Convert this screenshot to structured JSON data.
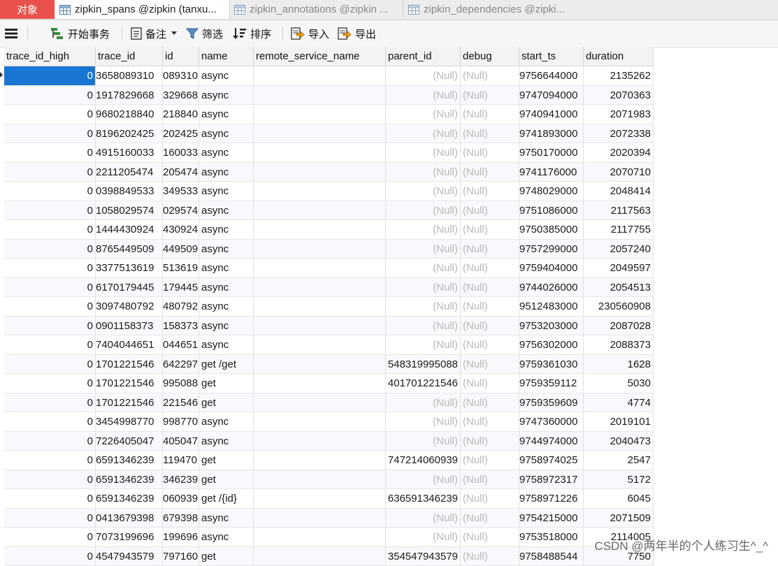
{
  "tabs": {
    "objects": "对象",
    "items": [
      {
        "label": "zipkin_spans @zipkin (tanxu..."
      },
      {
        "label": "zipkin_annotations @zipkin ..."
      },
      {
        "label": "zipkin_dependencies @zipki..."
      }
    ]
  },
  "toolbar": {
    "begin_transaction": "开始事务",
    "note": "备注",
    "filter": "筛选",
    "sort": "排序",
    "import": "导入",
    "export": "导出"
  },
  "columns": [
    "trace_id_high",
    "trace_id",
    "id",
    "name",
    "remote_service_name",
    "parent_id",
    "debug",
    "start_ts",
    "duration"
  ],
  "rows": [
    [
      "0",
      "3658089310",
      "089310",
      "async",
      "",
      "(Null)",
      "(Null)",
      "9756644000",
      "2135262"
    ],
    [
      "0",
      "1917829668",
      "329668",
      "async",
      "",
      "(Null)",
      "(Null)",
      "9747094000",
      "2070363"
    ],
    [
      "0",
      "9680218840",
      "218840",
      "async",
      "",
      "(Null)",
      "(Null)",
      "9740941000",
      "2071983"
    ],
    [
      "0",
      "8196202425",
      "202425",
      "async",
      "",
      "(Null)",
      "(Null)",
      "9741893000",
      "2072338"
    ],
    [
      "0",
      "4915160033",
      "160033",
      "async",
      "",
      "(Null)",
      "(Null)",
      "9750170000",
      "2020394"
    ],
    [
      "0",
      "2211205474",
      "205474",
      "async",
      "",
      "(Null)",
      "(Null)",
      "9741176000",
      "2070710"
    ],
    [
      "0",
      "0398849533",
      "349533",
      "async",
      "",
      "(Null)",
      "(Null)",
      "9748029000",
      "2048414"
    ],
    [
      "0",
      "1058029574",
      "029574",
      "async",
      "",
      "(Null)",
      "(Null)",
      "9751086000",
      "2117563"
    ],
    [
      "0",
      "1444430924",
      "430924",
      "async",
      "",
      "(Null)",
      "(Null)",
      "9750385000",
      "2117755"
    ],
    [
      "0",
      "8765449509",
      "449509",
      "async",
      "",
      "(Null)",
      "(Null)",
      "9757299000",
      "2057240"
    ],
    [
      "0",
      "3377513619",
      "513619",
      "async",
      "",
      "(Null)",
      "(Null)",
      "9759404000",
      "2049597"
    ],
    [
      "0",
      "6170179445",
      "179445",
      "async",
      "",
      "(Null)",
      "(Null)",
      "9744026000",
      "2054513"
    ],
    [
      "0",
      "3097480792",
      "480792",
      "async",
      "",
      "(Null)",
      "(Null)",
      "9512483000",
      "230560908"
    ],
    [
      "0",
      "0901158373",
      "158373",
      "async",
      "",
      "(Null)",
      "(Null)",
      "9753203000",
      "2087028"
    ],
    [
      "0",
      "7404044651",
      "044651",
      "async",
      "",
      "(Null)",
      "(Null)",
      "9756302000",
      "2088373"
    ],
    [
      "0",
      "1701221546",
      "642297",
      "get /get",
      "",
      "548319995088",
      "(Null)",
      "9759361030",
      "1628"
    ],
    [
      "0",
      "1701221546",
      "995088",
      "get",
      "",
      "401701221546",
      "(Null)",
      "9759359112",
      "5030"
    ],
    [
      "0",
      "1701221546",
      "221546",
      "get",
      "",
      "(Null)",
      "(Null)",
      "9759359609",
      "4774"
    ],
    [
      "0",
      "3454998770",
      "998770",
      "async",
      "",
      "(Null)",
      "(Null)",
      "9747360000",
      "2019101"
    ],
    [
      "0",
      "7226405047",
      "405047",
      "async",
      "",
      "(Null)",
      "(Null)",
      "9744974000",
      "2040473"
    ],
    [
      "0",
      "6591346239",
      "119470",
      "get",
      "",
      "747214060939",
      "(Null)",
      "9758974025",
      "2547"
    ],
    [
      "0",
      "6591346239",
      "346239",
      "get",
      "",
      "(Null)",
      "(Null)",
      "9758972317",
      "5172"
    ],
    [
      "0",
      "6591346239",
      "060939",
      "get /{id}",
      "",
      "636591346239",
      "(Null)",
      "9758971226",
      "6045"
    ],
    [
      "0",
      "0413679398",
      "679398",
      "async",
      "",
      "(Null)",
      "(Null)",
      "9754215000",
      "2071509"
    ],
    [
      "0",
      "7073199696",
      "199696",
      "async",
      "",
      "(Null)",
      "(Null)",
      "9753518000",
      "2114005"
    ],
    [
      "0",
      "4547943579",
      "797160",
      "get",
      "",
      "354547943579",
      "(Null)",
      "9758488544",
      "7750"
    ]
  ],
  "watermark": "CSDN @两年半的个人练习生^_^"
}
